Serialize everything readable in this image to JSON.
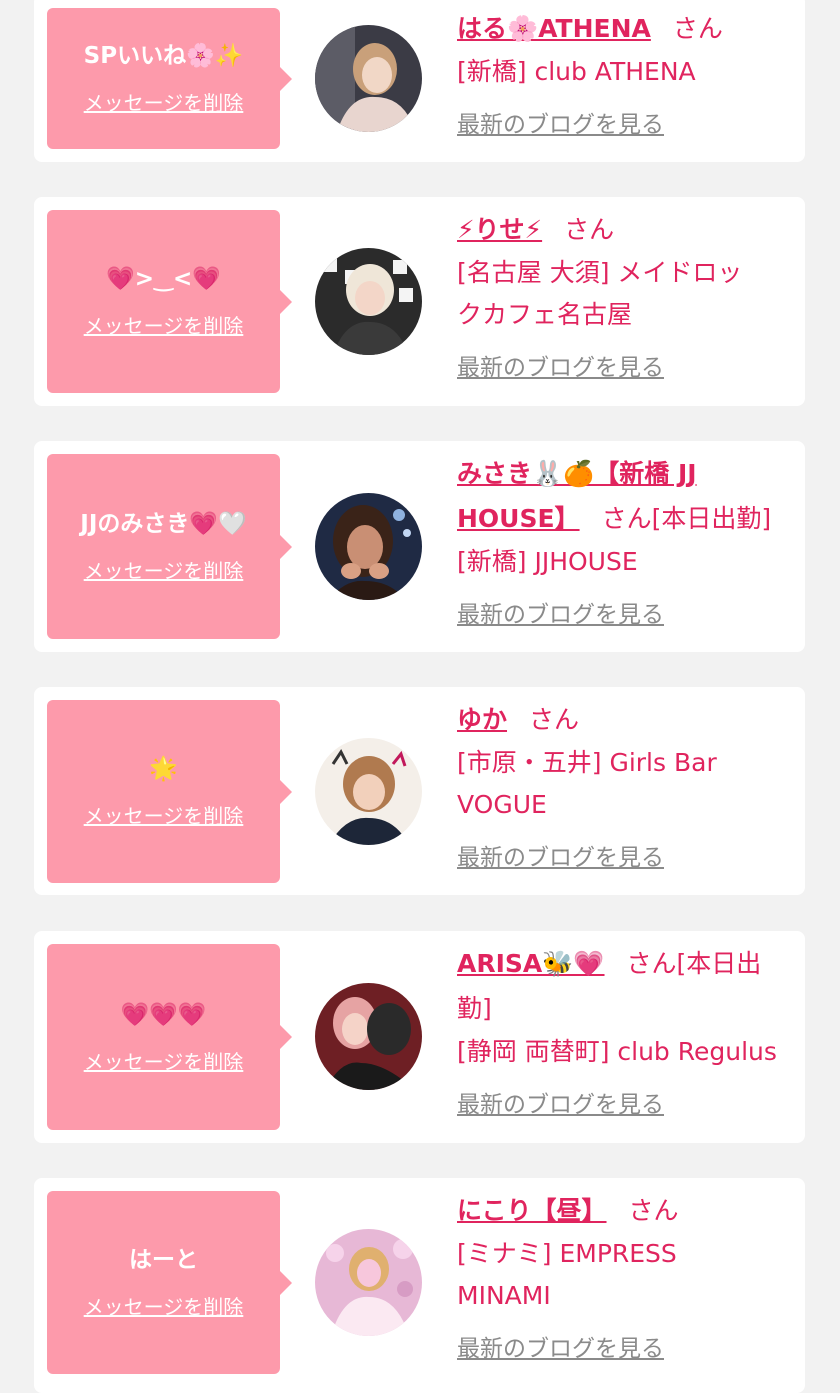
{
  "cards": [
    {
      "message": "SPいいね🌸✨",
      "delete_label": "メッセージを削除",
      "name": "はる🌸ATHENA",
      "san": "さん",
      "shop": "[新橋] club ATHENA",
      "blog_label": "最新のブログを見る",
      "avatar_colors": [
        "#3b3b45",
        "#e8d5cf"
      ]
    },
    {
      "message": "💗>‿<💗",
      "delete_label": "メッセージを削除",
      "name": "⚡りせ⚡",
      "san": "さん",
      "shop": "[名古屋 大須] メイドロックカフェ名古屋",
      "blog_label": "最新のブログを見る",
      "avatar_colors": [
        "#2b2b2b",
        "#efe6d8"
      ]
    },
    {
      "message": "JJのみさき💗🤍",
      "delete_label": "メッセージを削除",
      "name": "みさき🐰🍊【新橋 JJ HOUSE】",
      "san": "さん[本日出勤]",
      "shop": "[新橋] JJHOUSE",
      "blog_label": "最新のブログを見る",
      "avatar_colors": [
        "#1f2a44",
        "#c98f74"
      ]
    },
    {
      "message": "🌟",
      "delete_label": "メッセージを削除",
      "name": "ゆか",
      "san": "さん",
      "shop": "[市原・五井] Girls Bar VOGUE",
      "blog_label": "最新のブログを見る",
      "avatar_colors": [
        "#f4efe9",
        "#e3a27c"
      ]
    },
    {
      "message": "💗💗💗",
      "delete_label": "メッセージを削除",
      "name": "ARISA🐝💗",
      "san": "さん[本日出勤]",
      "shop": "[静岡 両替町] club Regulus",
      "blog_label": "最新のブログを見る",
      "avatar_colors": [
        "#6e1f24",
        "#e6a3a3"
      ]
    },
    {
      "message": "はーと",
      "delete_label": "メッセージを削除",
      "name": "にこり【昼】",
      "san": "さん",
      "shop": "[ミナミ] EMPRESS MINAMI",
      "blog_label": "最新のブログを見る",
      "avatar_colors": [
        "#e7b8d6",
        "#fbe9f2"
      ]
    }
  ]
}
